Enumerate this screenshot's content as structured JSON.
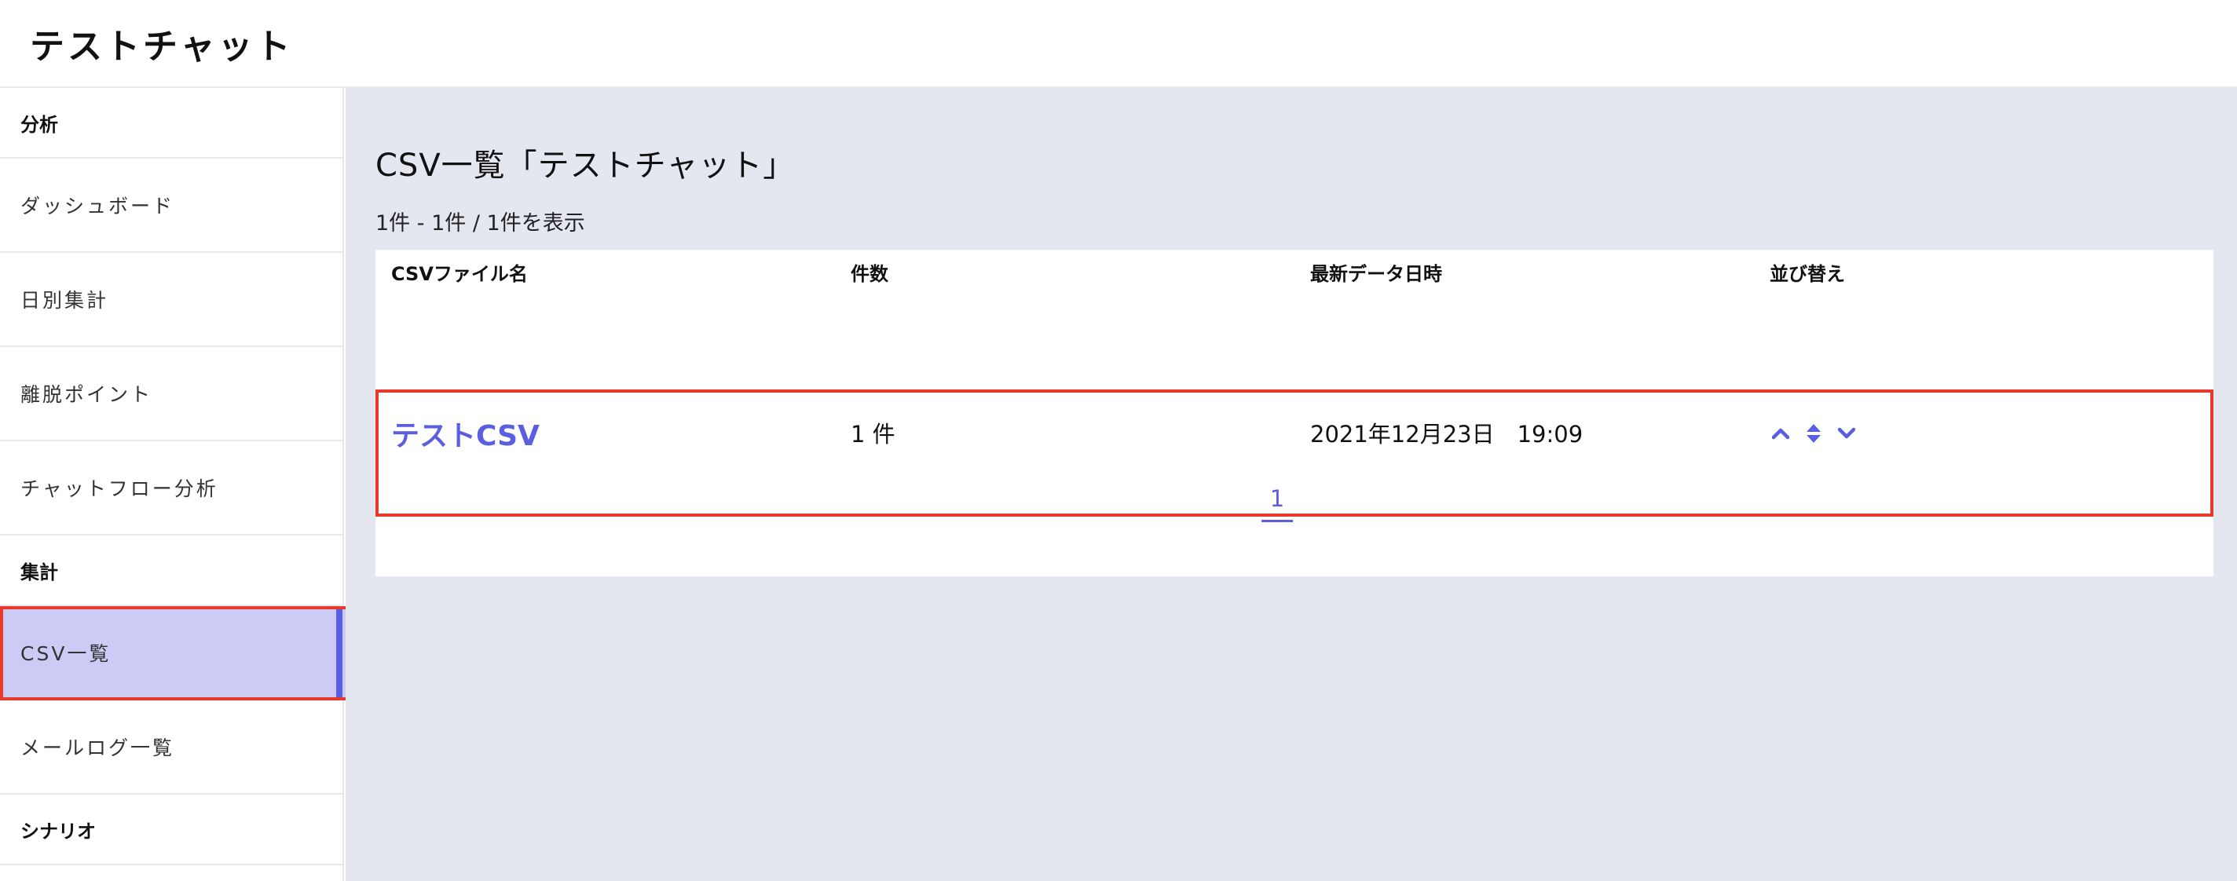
{
  "header": {
    "title": "テストチャット"
  },
  "sidebar": {
    "groups": [
      {
        "title": "分析",
        "items": [
          "ダッシュボード",
          "日別集計",
          "離脱ポイント",
          "チャットフロー分析"
        ]
      },
      {
        "title": "集計",
        "items": [
          "CSV一覧",
          "メールログ一覧"
        ]
      },
      {
        "title": "シナリオ",
        "items": []
      }
    ],
    "active_item": "CSV一覧"
  },
  "main": {
    "title": "CSV一覧「テストチャット」",
    "count_text": "1件 - 1件 / 1件を表示",
    "table": {
      "headers": [
        "CSVファイル名",
        "件数",
        "最新データ日時",
        "並び替え"
      ],
      "rows": [
        {
          "name": "テストCSV",
          "count": "1 件",
          "latest": "2021年12月23日　19:09"
        }
      ]
    },
    "pagination": {
      "current": "1"
    }
  },
  "colors": {
    "accent": "#5a5ee0",
    "highlight": "#e8392b",
    "active_bg": "#cbcbf5",
    "main_bg": "#e4e7ef"
  },
  "icons": {
    "sort_up": "chevron-up-icon",
    "sort_both": "sort-icon",
    "sort_down": "chevron-down-icon"
  }
}
